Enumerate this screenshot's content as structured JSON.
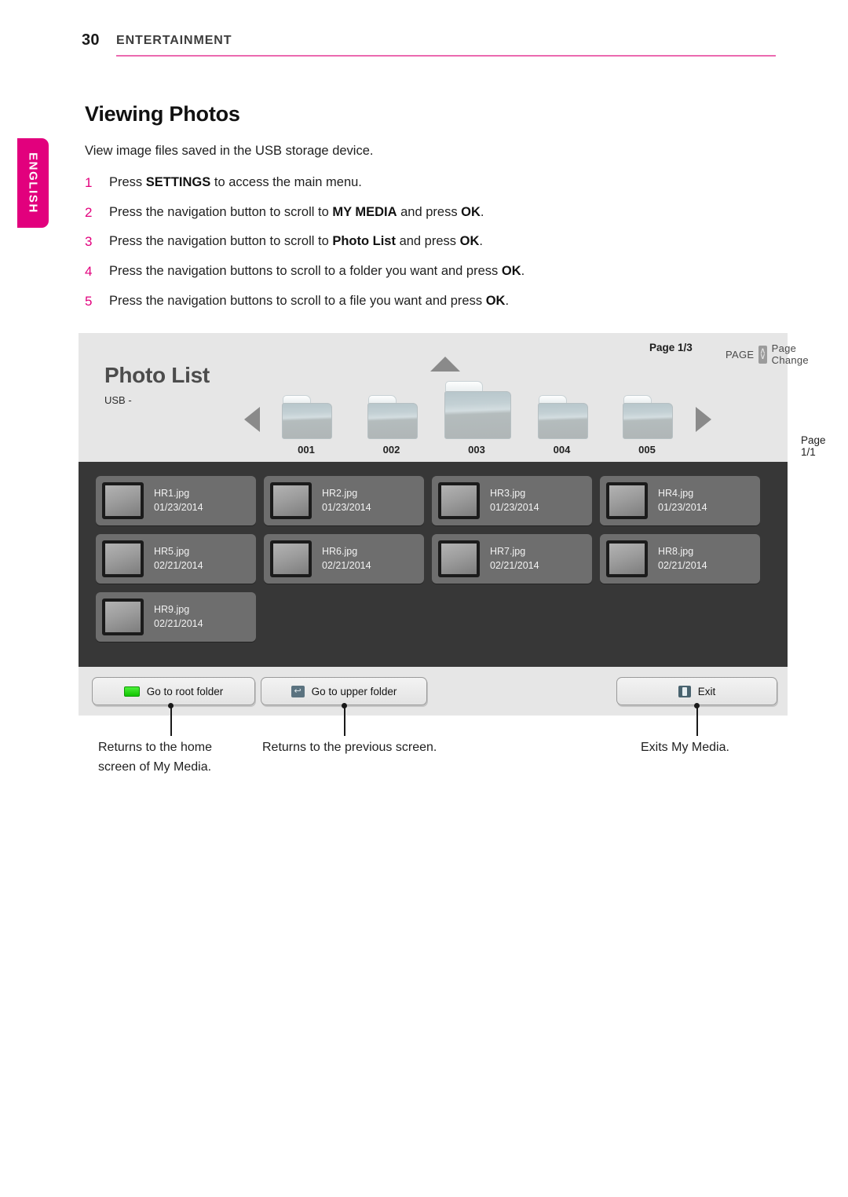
{
  "header": {
    "page_number": "30",
    "section": "ENTERTAINMENT",
    "rule_color": "#ec6ab0"
  },
  "language_tab": {
    "label": "ENGLISH",
    "color": "#e2007d"
  },
  "article": {
    "title": "Viewing Photos",
    "lead": "View image files saved in the USB storage device.",
    "steps": [
      {
        "num": "1",
        "pre": "Press ",
        "bold1": "SETTINGS",
        "mid": " to access the main menu.",
        "bold2": "",
        "post": ""
      },
      {
        "num": "2",
        "pre": "Press the navigation button to scroll to ",
        "bold1": "MY MEDIA",
        "mid": " and press ",
        "bold2": "OK",
        "post": "."
      },
      {
        "num": "3",
        "pre": "Press the navigation button to scroll to ",
        "bold1": "Photo List",
        "mid": " and press ",
        "bold2": "OK",
        "post": "."
      },
      {
        "num": "4",
        "pre": "Press the navigation buttons to scroll to a folder you want and press ",
        "bold1": "",
        "mid": "",
        "bold2": "OK",
        "post": "."
      },
      {
        "num": "5",
        "pre": "Press the navigation buttons to scroll to a file you want and press ",
        "bold1": "",
        "mid": "",
        "bold2": "OK",
        "post": "."
      }
    ]
  },
  "tv_screen": {
    "title": "Photo List",
    "subtitle": "USB -",
    "page_indicator": "Page 1/3",
    "page_change": {
      "key_label": "PAGE",
      "label": "Page Change",
      "up_glyph": "∧",
      "down_glyph": "∨"
    },
    "page_sub_indicator": "Page 1/1",
    "nav_left_icon": "triangle-left-icon",
    "nav_right_icon": "triangle-right-icon",
    "nav_up_icon": "triangle-up-icon",
    "folders": [
      {
        "label": "001",
        "selected": false
      },
      {
        "label": "002",
        "selected": false
      },
      {
        "label": "003",
        "selected": true
      },
      {
        "label": "004",
        "selected": false
      },
      {
        "label": "005",
        "selected": false
      }
    ],
    "files": [
      {
        "name": "HR1.jpg",
        "date": "01/23/2014"
      },
      {
        "name": "HR2.jpg",
        "date": "01/23/2014"
      },
      {
        "name": "HR3.jpg",
        "date": "01/23/2014"
      },
      {
        "name": "HR4.jpg",
        "date": "01/23/2014"
      },
      {
        "name": "HR5.jpg",
        "date": "02/21/2014"
      },
      {
        "name": "HR6.jpg",
        "date": "02/21/2014"
      },
      {
        "name": "HR7.jpg",
        "date": "02/21/2014"
      },
      {
        "name": "HR8.jpg",
        "date": "02/21/2014"
      },
      {
        "name": "HR9.jpg",
        "date": "02/21/2014"
      }
    ],
    "buttons": {
      "root": {
        "label": "Go to root folder",
        "icon": "green-key-icon"
      },
      "upper": {
        "label": "Go to upper folder",
        "icon": "back-arrow-icon",
        "glyph": "↩"
      },
      "exit": {
        "label": "Exit",
        "icon": "exit-door-icon"
      }
    }
  },
  "callouts": [
    {
      "text_line1": "Returns to the home",
      "text_line2": "screen of My Media."
    },
    {
      "text_line1": "Returns to the previous screen.",
      "text_line2": ""
    },
    {
      "text_line1": "Exits My Media.",
      "text_line2": ""
    }
  ]
}
